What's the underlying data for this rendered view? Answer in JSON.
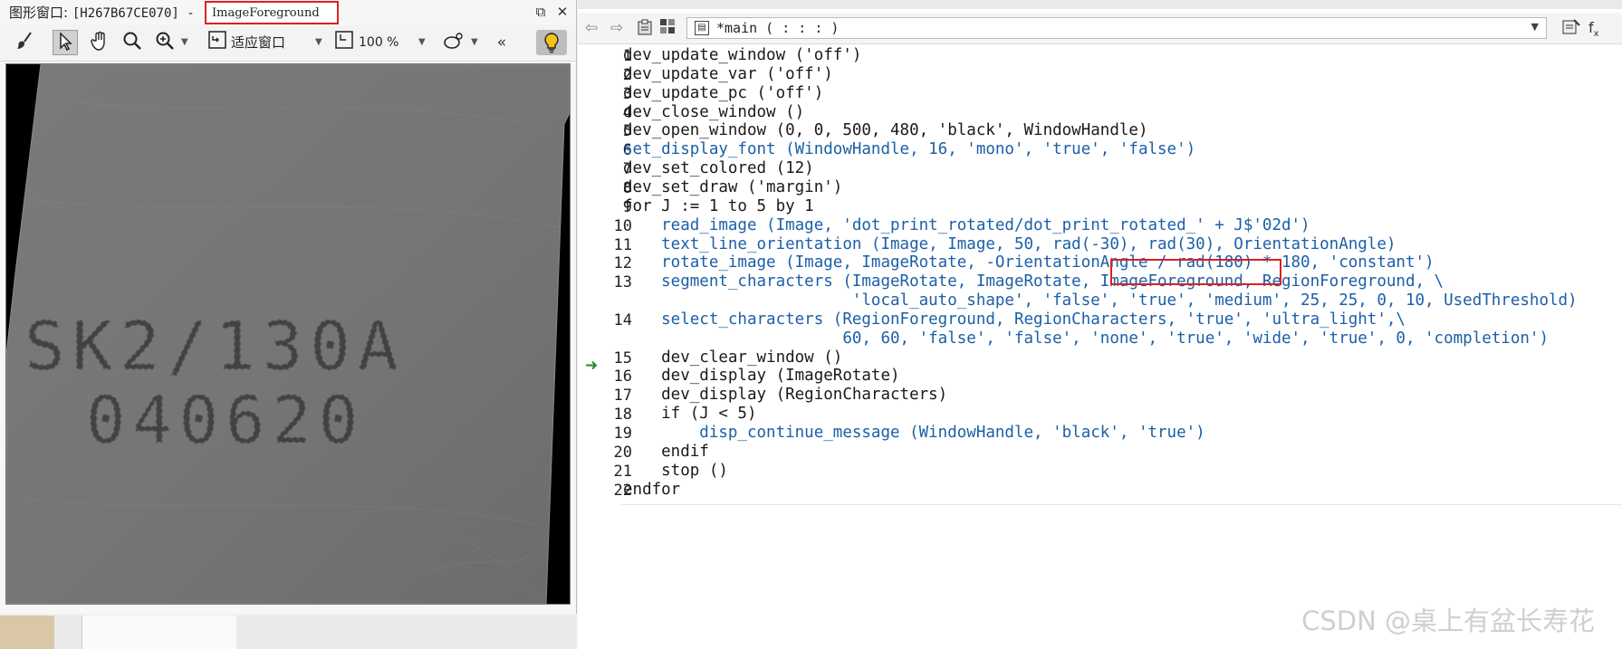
{
  "graphics_window": {
    "title_prefix": "图形窗口:",
    "title_id": "[H267B67CE070] -",
    "title_image_name": "ImageForeground",
    "toolbar": {
      "fit_label": "适应窗口",
      "zoom_label": "100 %",
      "overflow_label": "«"
    },
    "image_text_line1": "SK2/130A",
    "image_text_line2": "040620"
  },
  "editor": {
    "procedure_combo": "*main ( : : : )",
    "lines": [
      {
        "n": "1",
        "text": "dev_update_window ('off')"
      },
      {
        "n": "2",
        "text": "dev_update_var ('off')"
      },
      {
        "n": "3",
        "text": "dev_update_pc ('off')"
      },
      {
        "n": "4",
        "text": "dev_close_window ()"
      },
      {
        "n": "5",
        "text": "dev_open_window (0, 0, 500, 480, 'black', WindowHandle)"
      },
      {
        "n": "6",
        "text": "set_display_font (WindowHandle, 16, 'mono', 'true', 'false')"
      },
      {
        "n": "7",
        "text": "dev_set_colored (12)"
      },
      {
        "n": "8",
        "text": "dev_set_draw ('margin')"
      },
      {
        "n": "9",
        "text": "for J := 1 to 5 by 1"
      },
      {
        "n": "10",
        "text": "    read_image (Image, 'dot_print_rotated/dot_print_rotated_' + J$'02d')"
      },
      {
        "n": "11",
        "text": "    text_line_orientation (Image, Image, 50, rad(-30), rad(30), OrientationAngle)"
      },
      {
        "n": "12",
        "text": "    rotate_image (Image, ImageRotate, -OrientationAngle / rad(180) * 180, 'constant')"
      },
      {
        "n": "13",
        "text": "    segment_characters (ImageRotate, ImageRotate, ImageForeground, RegionForeground, \\"
      },
      {
        "n": "",
        "text": "                        'local_auto_shape', 'false', 'true', 'medium', 25, 25, 0, 10, UsedThreshold)"
      },
      {
        "n": "14",
        "text": "    select_characters (RegionForeground, RegionCharacters, 'true', 'ultra_light',\\"
      },
      {
        "n": "",
        "text": "                       60, 60, 'false', 'false', 'none', 'true', 'wide', 'true', 0, 'completion')"
      },
      {
        "n": "15",
        "text": "    dev_clear_window ()"
      },
      {
        "n": "16",
        "text": "    dev_display (ImageRotate)"
      },
      {
        "n": "17",
        "text": "    dev_display (RegionCharacters)"
      },
      {
        "n": "18",
        "text": "    if (J < 5)"
      },
      {
        "n": "19",
        "text": "        disp_continue_message (WindowHandle, 'black', 'true')"
      },
      {
        "n": "20",
        "text": "    endif"
      },
      {
        "n": "21",
        "text": "    stop ()"
      },
      {
        "n": "22",
        "text": "endfor"
      }
    ]
  },
  "watermark": "CSDN @桌上有盆长寿花",
  "colors": {
    "highlight_box": "#e02020",
    "operator_blue": "#1b5fa8",
    "pc_arrow": "#2e8b2e"
  }
}
